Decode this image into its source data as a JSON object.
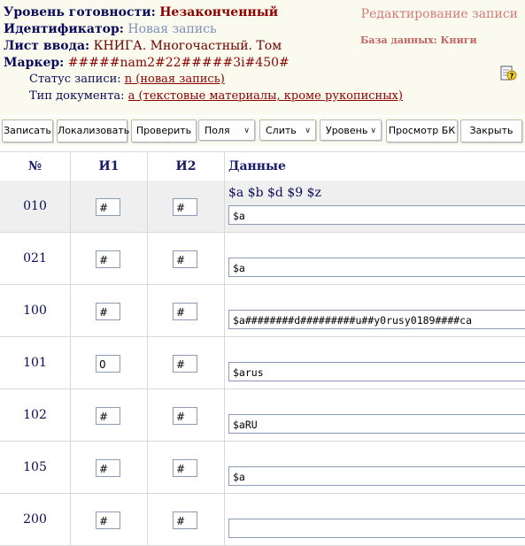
{
  "header": {
    "readiness": {
      "label": "Уровень готовности:",
      "value": "Незаконченный"
    },
    "identifier": {
      "label": "Идентификатор:",
      "value": "Новая запись"
    },
    "input_sheet": {
      "label": "Лист ввода:",
      "value": "КНИГА. Многочастный. Том"
    },
    "marker": {
      "label": "Маркер:",
      "value": "#####nam2#22#####3i#450#"
    },
    "record_status": {
      "label": "Статус записи:",
      "value": "n (новая запись)"
    },
    "doc_type": {
      "label": "Тип документа:",
      "value": "a (текстовые материалы, кроме рукописных)"
    },
    "title": "Редактирование записи",
    "database": "База данных: Книги"
  },
  "toolbar": {
    "save": "Записать",
    "localize": "Локализовать",
    "check": "Проверить",
    "fields": "Поля",
    "merge": "Слить",
    "level": "Уровень",
    "preview": "Просмотр БК",
    "close": "Закрыть"
  },
  "table": {
    "headers": {
      "num": "№",
      "i1": "И1",
      "i2": "И2",
      "data": "Данные"
    },
    "rows": [
      {
        "num": "010",
        "i1": "#",
        "i2": "#",
        "subfields": "$a $b $d $9 $z",
        "data": "$a"
      },
      {
        "num": "021",
        "i1": "#",
        "i2": "#",
        "subfields": "",
        "data": "$a"
      },
      {
        "num": "100",
        "i1": "#",
        "i2": "#",
        "subfields": "",
        "data": "$a########d#########u##y0rusy0189####ca"
      },
      {
        "num": "101",
        "i1": "0",
        "i2": "#",
        "subfields": "",
        "data": "$arus"
      },
      {
        "num": "102",
        "i1": "#",
        "i2": "#",
        "subfields": "",
        "data": "$aRU"
      },
      {
        "num": "105",
        "i1": "#",
        "i2": "#",
        "subfields": "",
        "data": "$a"
      },
      {
        "num": "200",
        "i1": "#",
        "i2": "#",
        "subfields": "",
        "data": ""
      }
    ]
  },
  "colors": {
    "label": "#0a0a5a",
    "value": "#8b0000",
    "title": "#d27a7a",
    "panel_bg": "#fbfaee",
    "selected_row": "#efefef"
  }
}
